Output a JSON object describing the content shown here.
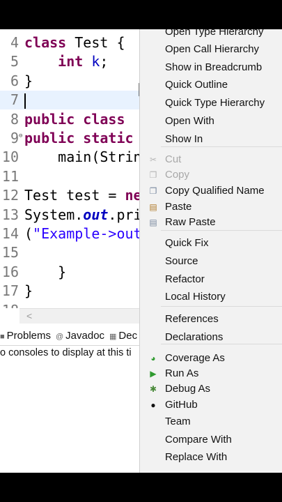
{
  "editor": {
    "lines": [
      {
        "num": "4",
        "tokens": [
          {
            "t": "class",
            "c": "kw"
          },
          {
            "t": " Test {",
            "c": "cls"
          }
        ]
      },
      {
        "num": "5",
        "tokens": [
          {
            "t": "    ",
            "c": "cls"
          },
          {
            "t": "int",
            "c": "kw"
          },
          {
            "t": " ",
            "c": "cls"
          },
          {
            "t": "k",
            "c": "fld"
          },
          {
            "t": ";",
            "c": "cls"
          }
        ]
      },
      {
        "num": "6",
        "tokens": [
          {
            "t": "}",
            "c": "cls"
          }
        ]
      },
      {
        "num": "7",
        "tokens": [],
        "current": true
      },
      {
        "num": "8",
        "tokens": [
          {
            "t": "public class",
            "c": "kw"
          }
        ]
      },
      {
        "num": "9",
        "fold": "⊖",
        "tokens": [
          {
            "t": "public static",
            "c": "kw"
          }
        ]
      },
      {
        "num": "10",
        "tokens": [
          {
            "t": "    main(Strin",
            "c": "cls"
          }
        ]
      },
      {
        "num": "11",
        "tokens": []
      },
      {
        "num": "12",
        "tokens": [
          {
            "t": "Test test = ",
            "c": "cls"
          },
          {
            "t": "ne",
            "c": "kw"
          }
        ]
      },
      {
        "num": "13",
        "tokens": [
          {
            "t": "System.",
            "c": "cls"
          },
          {
            "t": "out",
            "c": "stat"
          },
          {
            "t": ".pri",
            "c": "cls"
          }
        ]
      },
      {
        "num": "14",
        "tokens": [
          {
            "t": "(",
            "c": "cls"
          },
          {
            "t": "\"Example->out",
            "c": "str"
          }
        ]
      },
      {
        "num": "15",
        "tokens": []
      },
      {
        "num": "16",
        "tokens": [
          {
            "t": "    }",
            "c": "cls"
          }
        ]
      },
      {
        "num": "17",
        "tokens": [
          {
            "t": "}",
            "c": "cls"
          }
        ]
      },
      {
        "num": "18",
        "tokens": []
      }
    ]
  },
  "views": {
    "tabs": [
      {
        "label": "Problems",
        "icon": "problems-icon"
      },
      {
        "label": "Javadoc",
        "icon": "javadoc-icon"
      },
      {
        "label": "Dec",
        "icon": "declaration-icon"
      }
    ],
    "console_message": "o consoles to display at this ti"
  },
  "context_menu": {
    "items": [
      {
        "label": "Open Type Hierarchy",
        "enabled": true
      },
      {
        "label": "Open Call Hierarchy",
        "enabled": true
      },
      {
        "label": "Show in Breadcrumb",
        "enabled": true
      },
      {
        "label": "Quick Outline",
        "enabled": true
      },
      {
        "label": "Quick Type Hierarchy",
        "enabled": true
      },
      {
        "label": "Open With",
        "enabled": true
      },
      {
        "label": "Show In",
        "enabled": true
      },
      {
        "label": "Cut",
        "enabled": false,
        "icon": "cut-icon"
      },
      {
        "label": "Copy",
        "enabled": false,
        "icon": "copy-icon"
      },
      {
        "label": "Copy Qualified Name",
        "enabled": true,
        "icon": "copy-qualified-icon"
      },
      {
        "label": "Paste",
        "enabled": true,
        "icon": "paste-icon"
      },
      {
        "label": "Raw Paste",
        "enabled": true,
        "icon": "raw-paste-icon"
      },
      {
        "label": "Quick Fix",
        "enabled": true
      },
      {
        "label": "Source",
        "enabled": true
      },
      {
        "label": "Refactor",
        "enabled": true
      },
      {
        "label": "Local History",
        "enabled": true
      },
      {
        "label": "References",
        "enabled": true
      },
      {
        "label": "Declarations",
        "enabled": true
      },
      {
        "label": "Coverage As",
        "enabled": true,
        "icon": "coverage-icon"
      },
      {
        "label": "Run As",
        "enabled": true,
        "icon": "run-icon"
      },
      {
        "label": "Debug As",
        "enabled": true,
        "icon": "debug-icon"
      },
      {
        "label": "GitHub",
        "enabled": true,
        "icon": "github-icon"
      },
      {
        "label": "Team",
        "enabled": true
      },
      {
        "label": "Compare With",
        "enabled": true
      },
      {
        "label": "Replace With",
        "enabled": true
      }
    ]
  }
}
